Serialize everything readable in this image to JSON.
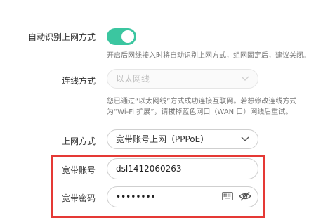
{
  "auto_detect": {
    "label": "自动识别上网方式",
    "enabled": true,
    "hint": "开启后网线接入时将自动识别上网方式，组网固定后，建议关闭。"
  },
  "connection": {
    "label": "连线方式",
    "value": "以太网线",
    "hint_line1": "您已通过“以太网线”方式成功连接互联网。若想修改连线方式",
    "hint_line2": "为“Wi-Fi 扩展”，请拔掉蓝色网口（WAN 口）网线后重试。"
  },
  "internet_mode": {
    "label": "上网方式",
    "value": "宽带账号上网（PPPoE）"
  },
  "account": {
    "label": "宽带账号",
    "value": "dsl1412060263"
  },
  "password": {
    "label": "宽带密码",
    "value": "••••••••"
  },
  "icons": {
    "chevron": "chevron-down-icon",
    "keyboard": "keyboard-icon",
    "visibility": "eye-icon"
  },
  "colors": {
    "toggle_on": "#3bc6a0",
    "highlight": "#e53935"
  }
}
